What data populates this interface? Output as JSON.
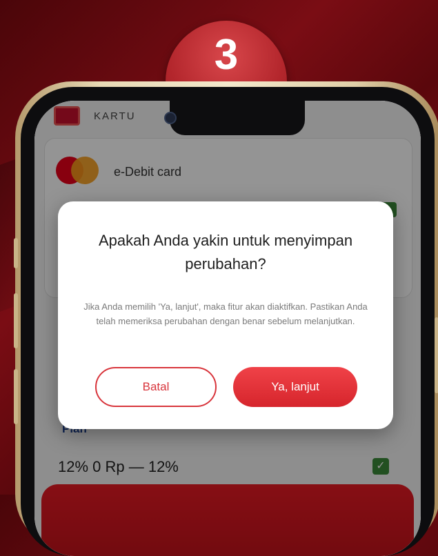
{
  "step": {
    "number": "3"
  },
  "app": {
    "header_text": "KARTU",
    "card_label": "e-Debit card",
    "card_number": "",
    "below_label": "Plan",
    "below_sub": "",
    "below_limit": "12% 0 Rp — 12%"
  },
  "dialog": {
    "title": "Apakah Anda yakin untuk menyimpan perubahan?",
    "body": "Jika Anda memilih 'Ya, lanjut', maka fitur akan diaktifkan. Pastikan Anda telah memeriksa perubahan dengan benar sebelum melanjutkan.",
    "cancel_label": "Batal",
    "continue_label": "Ya, lanjut"
  },
  "colors": {
    "accent_red": "#d8343b",
    "background": "#6a0a10",
    "confirm_green": "#3c8a3a"
  },
  "icons": {
    "card_brand": "mastercard-logo",
    "check": "check-icon"
  }
}
